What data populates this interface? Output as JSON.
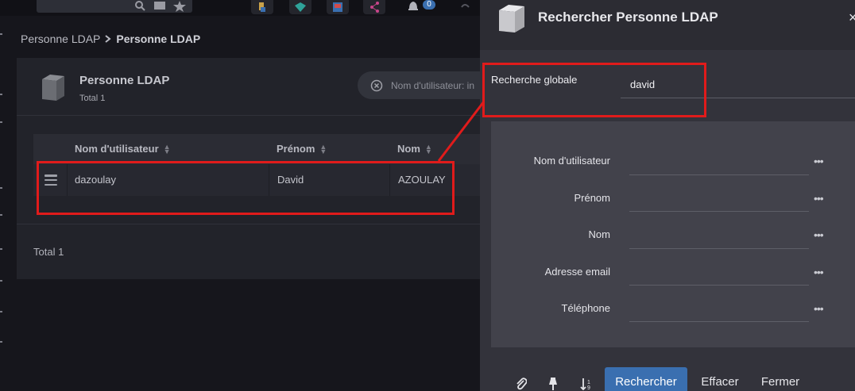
{
  "breadcrumb": {
    "parent": "Personne LDAP",
    "current": "Personne LDAP"
  },
  "notifications": {
    "count": "0"
  },
  "panel": {
    "title": "Personne LDAP",
    "subtitle": "Total 1",
    "filter_chip": "Nom d'utilisateur: in",
    "columns": [
      "Nom d'utilisateur",
      "Prénom",
      "Nom"
    ],
    "rows": [
      {
        "username": "dazoulay",
        "first_name": "David",
        "last_name": "AZOULAY"
      }
    ],
    "footer_total": "Total 1"
  },
  "dialog": {
    "title": "Rechercher Personne LDAP",
    "close_glyph": "×",
    "global_search": {
      "label": "Recherche globale",
      "value": "david"
    },
    "fields": [
      {
        "label": "Nom d'utilisateur",
        "dots": "•••"
      },
      {
        "label": "Prénom",
        "dots": "•••"
      },
      {
        "label": "Nom",
        "dots": "•••"
      },
      {
        "label": "Adresse email",
        "dots": "•••"
      },
      {
        "label": "Téléphone",
        "dots": "•••"
      }
    ],
    "buttons": {
      "search": "Rechercher",
      "clear": "Effacer",
      "close": "Fermer"
    }
  },
  "colors": {
    "accent": "#3a6fb0",
    "annotation": "#e01b1b",
    "background": "#16161c",
    "dialog": "#33333b"
  },
  "icons": [
    "search-icon",
    "folder-icon",
    "star-icon",
    "bell-icon",
    "cube-icon",
    "paperclip-icon",
    "pin-icon",
    "sort-icon",
    "menu-icon",
    "close-icon"
  ]
}
